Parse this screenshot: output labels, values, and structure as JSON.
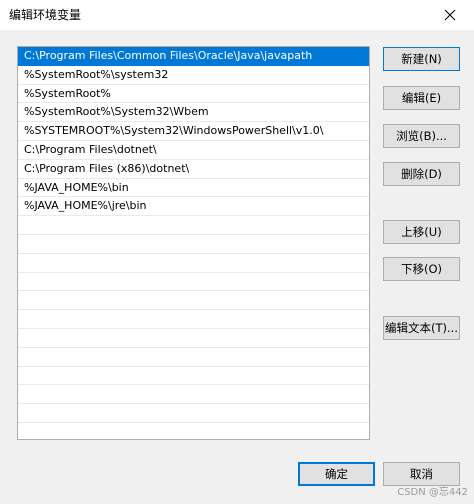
{
  "window": {
    "title": "编辑环境变量"
  },
  "paths": [
    "C:\\Program Files\\Common Files\\Oracle\\Java\\javapath",
    "%SystemRoot%\\system32",
    "%SystemRoot%",
    "%SystemRoot%\\System32\\Wbem",
    "%SYSTEMROOT%\\System32\\WindowsPowerShell\\v1.0\\",
    "C:\\Program Files\\dotnet\\",
    "C:\\Program Files (x86)\\dotnet\\",
    "%JAVA_HOME%\\bin",
    "%JAVA_HOME%\\jre\\bin",
    "",
    "",
    "",
    "",
    "",
    "",
    "",
    "",
    "",
    "",
    "",
    ""
  ],
  "selected_index": 0,
  "buttons": {
    "new": "新建(N)",
    "edit": "编辑(E)",
    "browse": "浏览(B)...",
    "delete": "删除(D)",
    "move_up": "上移(U)",
    "move_down": "下移(O)",
    "edit_text": "编辑文本(T)...",
    "ok": "确定",
    "cancel": "取消"
  },
  "watermark": "CSDN @忘442",
  "colors": {
    "selection": "#0078d7",
    "button_face": "#e1e1e1"
  },
  "icons": {
    "close": "close-icon"
  }
}
